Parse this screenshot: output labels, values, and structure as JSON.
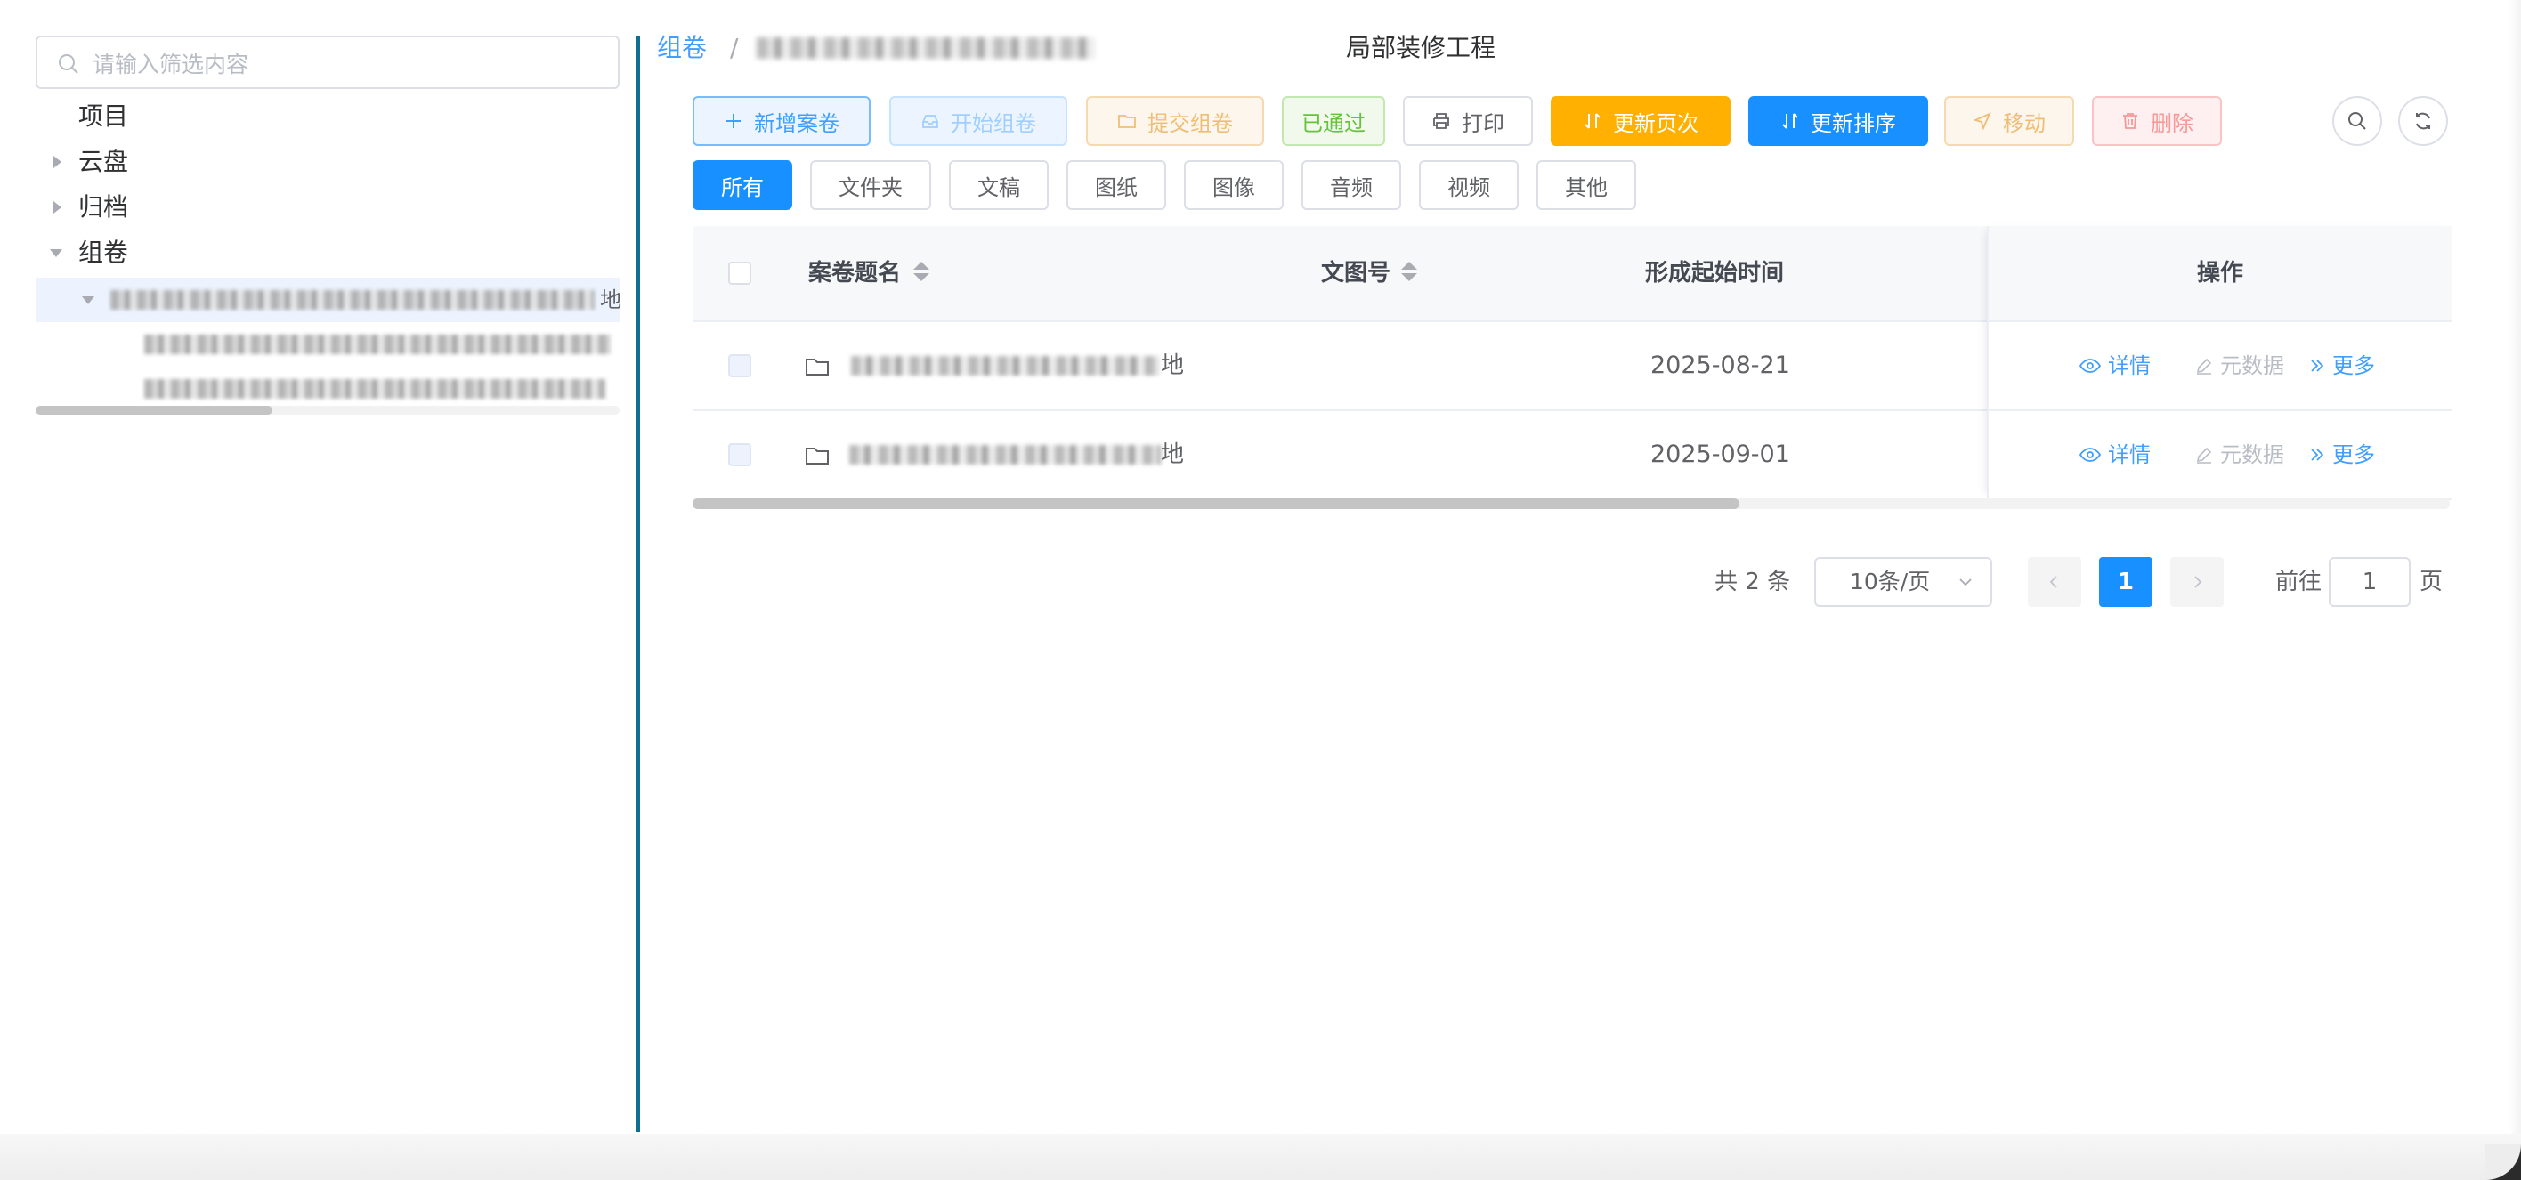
{
  "sidebar": {
    "search_placeholder": "请输入筛选内容",
    "tree": [
      {
        "label": "项目",
        "expanded": null
      },
      {
        "label": "云盘",
        "expanded": false
      },
      {
        "label": "归档",
        "expanded": false
      },
      {
        "label": "组卷",
        "expanded": true
      }
    ],
    "selected_child_tail": "地",
    "grandchild_tail_1": "(",
    "grandchild_tail_2": ""
  },
  "breadcrumb": {
    "first": "组卷",
    "separator": "/",
    "last": "局部装修工程"
  },
  "toolbar": {
    "add": "新增案卷",
    "start": "开始组卷",
    "submit": "提交组卷",
    "passed": "已通过",
    "print": "打印",
    "update_pages": "更新页次",
    "update_order": "更新排序",
    "move": "移动",
    "delete": "删除"
  },
  "filters": [
    "所有",
    "文件夹",
    "文稿",
    "图纸",
    "图像",
    "音频",
    "视频",
    "其他"
  ],
  "filters_active": "所有",
  "table": {
    "columns": {
      "title": "案卷题名",
      "doc_no": "文图号",
      "start_time": "形成起始时间",
      "ops": "操作"
    },
    "rows": [
      {
        "title_tail": "地",
        "doc_no": "",
        "start_time": "2025-08-21"
      },
      {
        "title_tail": "地",
        "doc_no": "",
        "start_time": "2025-09-01"
      }
    ],
    "ops": {
      "detail": "详情",
      "metadata": "元数据",
      "more": "更多"
    }
  },
  "pagination": {
    "total": "共 2 条",
    "page_size": "10条/页",
    "current": "1",
    "goto_label": "前往",
    "goto_value": "1",
    "page_unit": "页"
  },
  "colors": {
    "accent": "#1890ff",
    "warning": "#ffb000",
    "link": "#409eff",
    "splitter": "#0e6f8f"
  }
}
